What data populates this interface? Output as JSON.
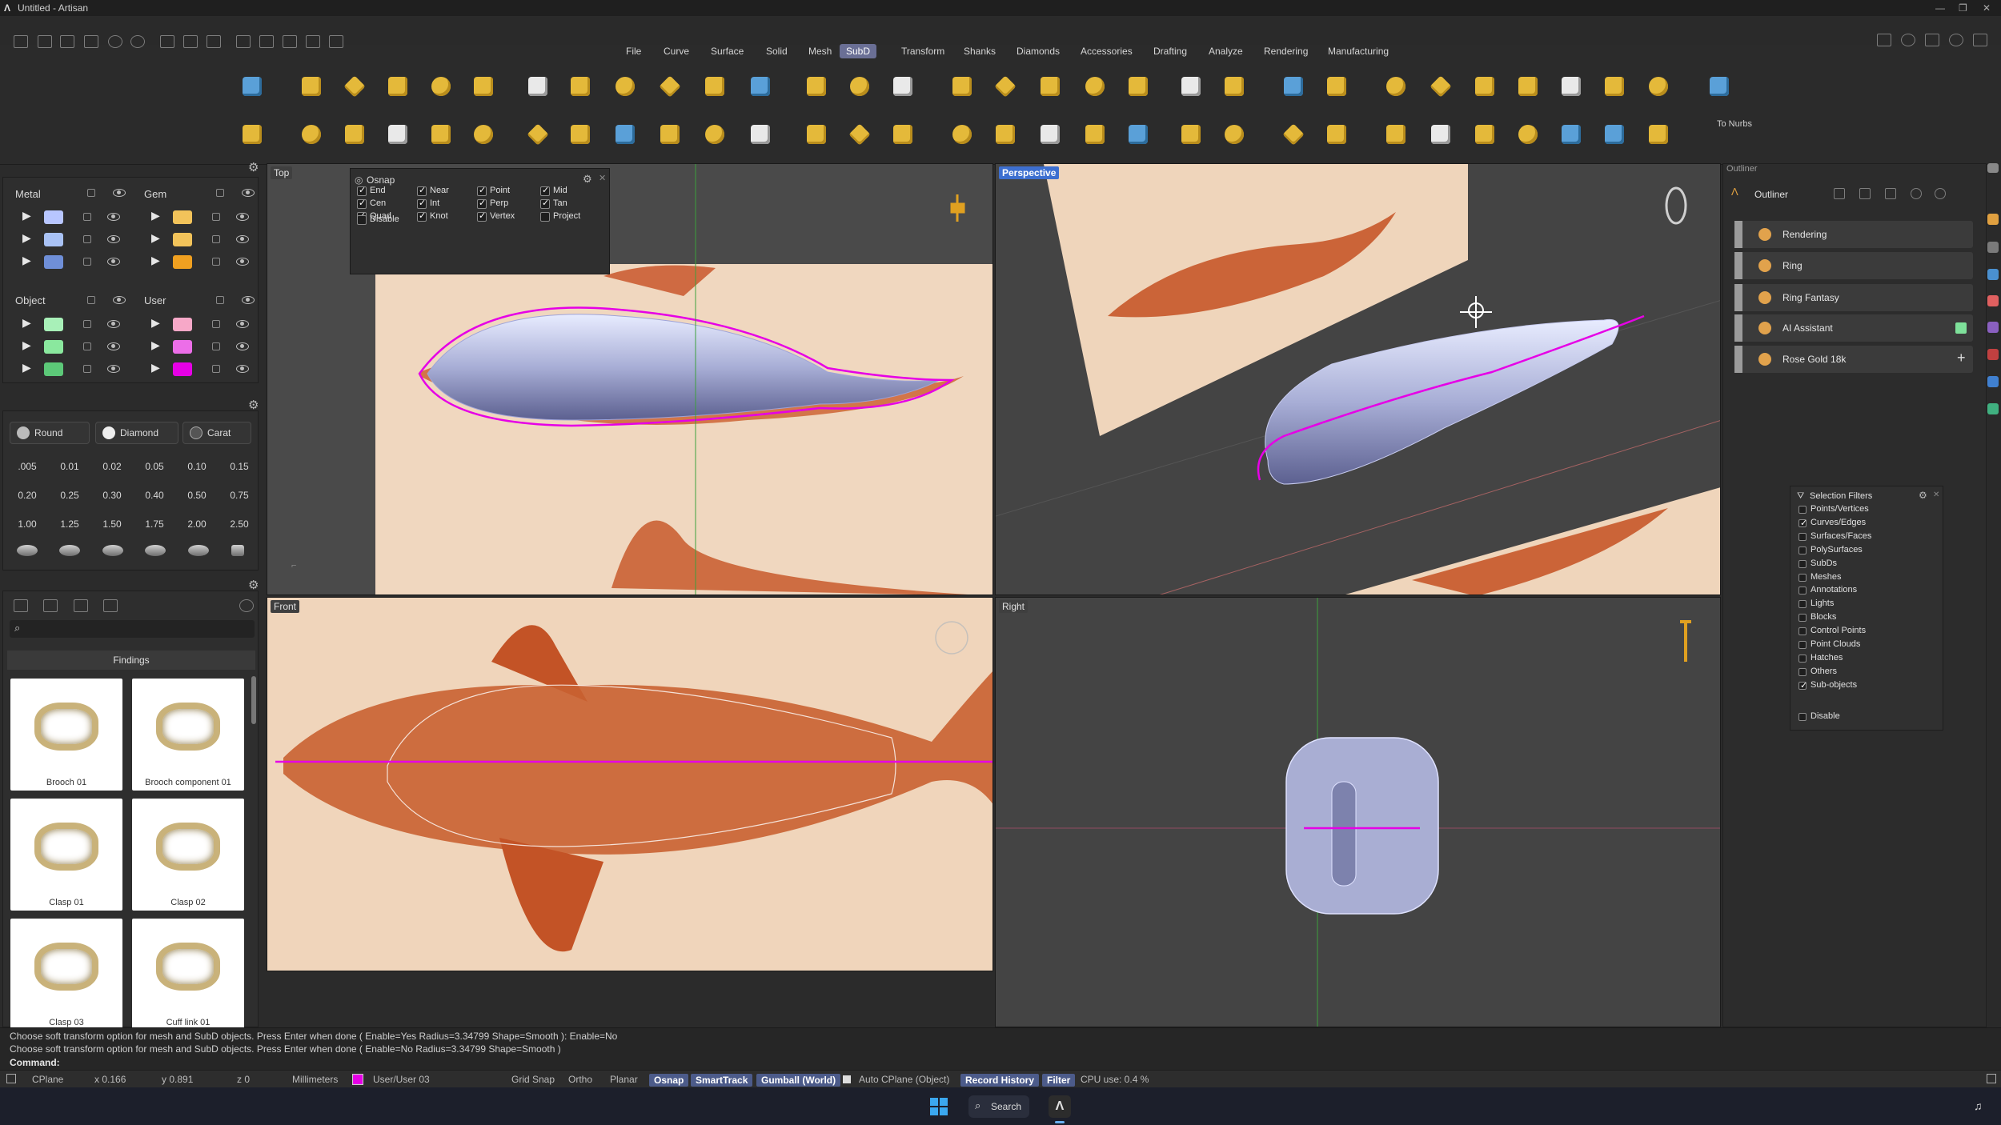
{
  "window": {
    "title": "Untitled - Artisan"
  },
  "menu_tabs": [
    {
      "label": "File"
    },
    {
      "label": "Curve"
    },
    {
      "label": "Surface"
    },
    {
      "label": "Solid"
    },
    {
      "label": "Mesh"
    },
    {
      "label": "SubD",
      "active": true
    },
    {
      "label": "Transform"
    },
    {
      "label": "Shanks"
    },
    {
      "label": "Diamonds"
    },
    {
      "label": "Accessories"
    },
    {
      "label": "Drafting"
    },
    {
      "label": "Analyze"
    },
    {
      "label": "Rendering"
    },
    {
      "label": "Manufacturing"
    }
  ],
  "ribbon": {
    "to_nurbs_label": "To Nurbs"
  },
  "layers": {
    "groups": [
      {
        "name": "Metal",
        "colors": [
          "#b8c6ff",
          "#a9c2f5",
          "#6f8fd8"
        ]
      },
      {
        "name": "Gem",
        "colors": [
          "#f2c35a",
          "#f2c35a",
          "#f0a020"
        ]
      },
      {
        "name": "Object",
        "colors": [
          "#a8f0b8",
          "#8ae89e",
          "#5cc878"
        ]
      },
      {
        "name": "User",
        "colors": [
          "#f7a8c8",
          "#ec6ee8",
          "#e600e6"
        ]
      }
    ]
  },
  "gems": {
    "shape_label": "Round",
    "type_label": "Diamond",
    "unit_label": "Carat",
    "sizes": [
      ".005",
      "0.01",
      "0.02",
      "0.05",
      "0.10",
      "0.15",
      "0.20",
      "0.25",
      "0.30",
      "0.40",
      "0.50",
      "0.75",
      "1.00",
      "1.25",
      "1.50",
      "1.75",
      "2.00",
      "2.50"
    ]
  },
  "library": {
    "category": "Findings",
    "items": [
      {
        "label": "Brooch 01"
      },
      {
        "label": "Brooch component 01"
      },
      {
        "label": "Clasp 01"
      },
      {
        "label": "Clasp 02"
      },
      {
        "label": "Clasp 03"
      },
      {
        "label": "Cuff link 01"
      }
    ]
  },
  "viewports": [
    {
      "label": "Top"
    },
    {
      "label": "Perspective"
    },
    {
      "label": "Front"
    },
    {
      "label": "Right"
    }
  ],
  "osnap": {
    "title": "Osnap",
    "items": [
      {
        "label": "End",
        "checked": true
      },
      {
        "label": "Near",
        "checked": true
      },
      {
        "label": "Point",
        "checked": true
      },
      {
        "label": "Mid",
        "checked": true
      },
      {
        "label": "Cen",
        "checked": true
      },
      {
        "label": "Int",
        "checked": true
      },
      {
        "label": "Perp",
        "checked": true
      },
      {
        "label": "Tan",
        "checked": true
      },
      {
        "label": "Quad",
        "checked": true
      },
      {
        "label": "Knot",
        "checked": true
      },
      {
        "label": "Vertex",
        "checked": true
      },
      {
        "label": "Project",
        "checked": false
      },
      {
        "label": "Disable",
        "checked": false
      }
    ]
  },
  "outliner": {
    "section": "Outliner",
    "title": "Outliner",
    "items": [
      {
        "label": "Rendering"
      },
      {
        "label": "Ring"
      },
      {
        "label": "Ring Fantasy"
      },
      {
        "label": "AI Assistant"
      },
      {
        "label": "Rose Gold 18k"
      }
    ]
  },
  "selection_filters": {
    "title": "Selection Filters",
    "items": [
      {
        "label": "Points/Vertices",
        "checked": false
      },
      {
        "label": "Curves/Edges",
        "checked": true
      },
      {
        "label": "Surfaces/Faces",
        "checked": false
      },
      {
        "label": "PolySurfaces",
        "checked": false
      },
      {
        "label": "SubDs",
        "checked": false
      },
      {
        "label": "Meshes",
        "checked": false
      },
      {
        "label": "Annotations",
        "checked": false
      },
      {
        "label": "Lights",
        "checked": false
      },
      {
        "label": "Blocks",
        "checked": false
      },
      {
        "label": "Control Points",
        "checked": false
      },
      {
        "label": "Point Clouds",
        "checked": false
      },
      {
        "label": "Hatches",
        "checked": false
      },
      {
        "label": "Others",
        "checked": false
      },
      {
        "label": "Sub-objects",
        "checked": true
      },
      {
        "label": "Disable",
        "checked": false
      }
    ]
  },
  "command": {
    "history": [
      "Choose soft transform option for mesh and SubD objects. Press Enter when done ( Enable=Yes  Radius=3.34799  Shape=Smooth ): Enable=No",
      "Choose soft transform option for mesh and SubD objects. Press Enter when done ( Enable=No  Radius=3.34799  Shape=Smooth )"
    ],
    "prompt": "Command:"
  },
  "status": {
    "items": [
      {
        "label": "CPlane",
        "on": false
      },
      {
        "label": "x 0.166",
        "on": false
      },
      {
        "label": "y 0.891",
        "on": false
      },
      {
        "label": "z 0",
        "on": false
      },
      {
        "label": "Millimeters",
        "on": false
      },
      {
        "label": "User/User 03",
        "on": false
      },
      {
        "label": "Grid Snap",
        "on": false
      },
      {
        "label": "Ortho",
        "on": false
      },
      {
        "label": "Planar",
        "on": false
      },
      {
        "label": "Osnap",
        "on": true
      },
      {
        "label": "SmartTrack",
        "on": true
      },
      {
        "label": "Gumball (World)",
        "on": true
      },
      {
        "label": "Auto CPlane (Object)",
        "on": false
      },
      {
        "label": "Record History",
        "on": true
      },
      {
        "label": "Filter",
        "on": true
      },
      {
        "label": "CPU use: 0.4 %",
        "on": false
      }
    ]
  },
  "taskbar": {
    "search_label": "Search"
  }
}
